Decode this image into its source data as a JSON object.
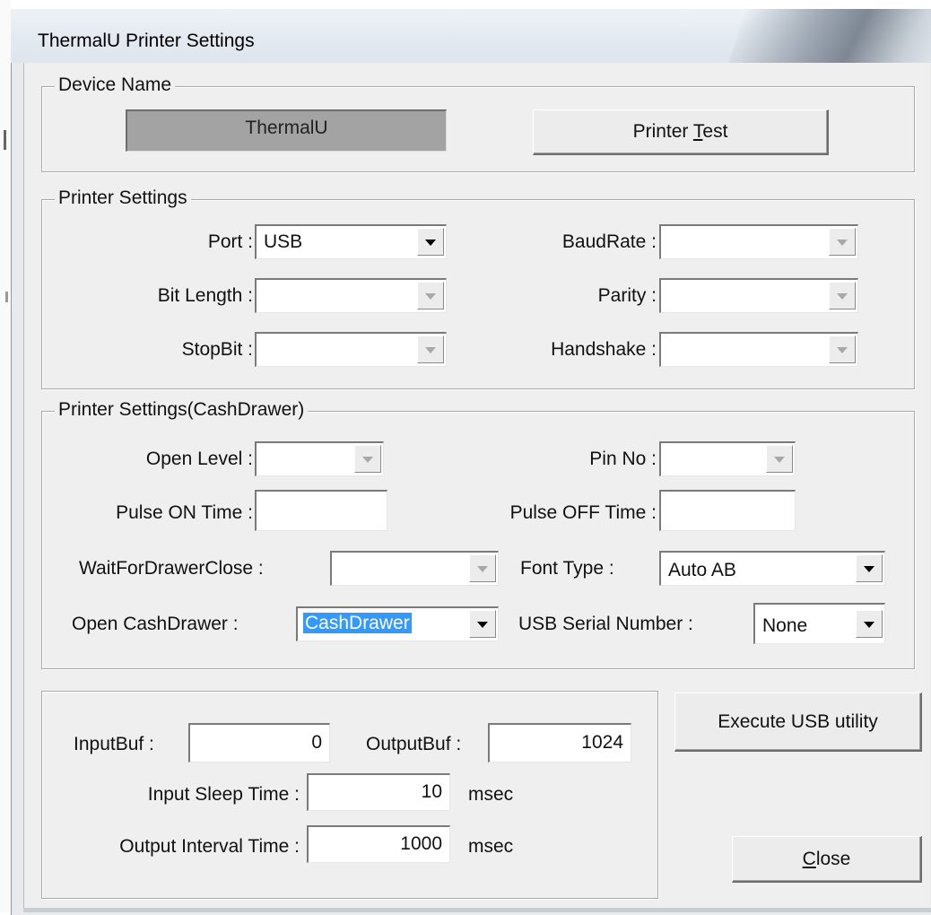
{
  "window": {
    "title": "ThermalU Printer Settings"
  },
  "device_name": {
    "legend": "Device Name",
    "value": "ThermalU",
    "printer_test_prefix": "Printer ",
    "printer_test_accel": "T",
    "printer_test_suffix": "est"
  },
  "printer_settings": {
    "legend": "Printer Settings",
    "port_label": "Port :",
    "port_value": "USB",
    "baudrate_label": "BaudRate :",
    "baudrate_value": "",
    "bit_length_label": "Bit Length :",
    "bit_length_value": "",
    "parity_label": "Parity :",
    "parity_value": "",
    "stopbit_label": "StopBit :",
    "stopbit_value": "",
    "handshake_label": "Handshake :",
    "handshake_value": ""
  },
  "cash_drawer": {
    "legend": "Printer Settings(CashDrawer)",
    "open_level_label": "Open Level :",
    "open_level_value": "",
    "pin_no_label": "Pin No :",
    "pin_no_value": "",
    "pulse_on_label": "Pulse ON Time :",
    "pulse_on_value": "",
    "pulse_off_label": "Pulse OFF Time :",
    "pulse_off_value": "",
    "wait_close_label": "WaitForDrawerClose :",
    "wait_close_value": "",
    "font_type_label": "Font Type :",
    "font_type_value": "Auto AB",
    "open_cashdrawer_label": "Open CashDrawer :",
    "open_cashdrawer_value": "CashDrawer",
    "usb_serial_label": "USB Serial Number :",
    "usb_serial_value": "None"
  },
  "buffers": {
    "inputbuf_label": "InputBuf :",
    "inputbuf_value": "0",
    "outputbuf_label": "OutputBuf :",
    "outputbuf_value": "1024",
    "input_sleep_label": "Input Sleep Time :",
    "input_sleep_value": "10",
    "input_sleep_unit": "msec",
    "output_interval_label": "Output Interval Time :",
    "output_interval_value": "1000",
    "output_interval_unit": "msec"
  },
  "actions": {
    "execute_usb_label": "Execute USB utility",
    "close_accel": "C",
    "close_suffix": "lose"
  }
}
